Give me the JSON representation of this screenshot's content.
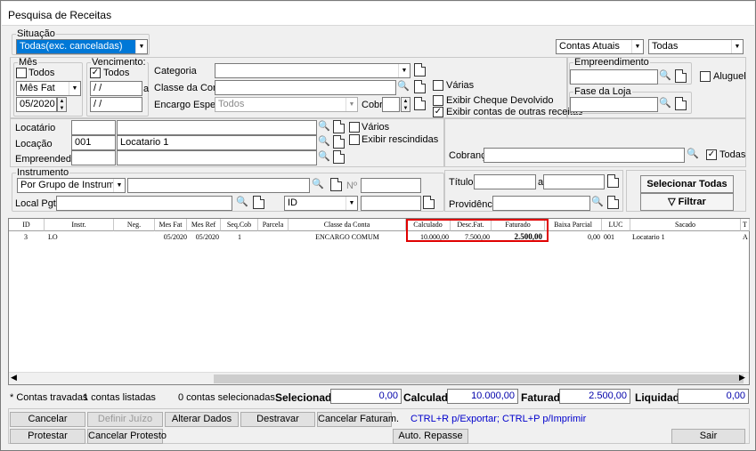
{
  "window": {
    "title": "Pesquisa de Receitas"
  },
  "situacao": {
    "legend": "Situação",
    "value": "Todas(exc. canceladas)"
  },
  "contas": {
    "value": "Contas Atuais",
    "todas": "Todas"
  },
  "mes": {
    "legend": "Mês",
    "todos_label": "Todos",
    "todos_checked": false,
    "tipo": "Mês Fat",
    "periodo": "05/2020"
  },
  "vencimento": {
    "legend": "Vencimento:",
    "todos_label": "Todos",
    "todos_checked": true,
    "de": "/ /",
    "a_label": "a",
    "ate": "/ /"
  },
  "categoria": {
    "label": "Categoria",
    "value": ""
  },
  "classe_conta": {
    "label": "Classe da Conta",
    "value": ""
  },
  "encargo": {
    "label": "Encargo Espec.",
    "value": "Todos"
  },
  "cobr": {
    "label": "Cobr",
    "value": ""
  },
  "varias": {
    "label": "Várias",
    "checked": false
  },
  "cheque": {
    "label": "Exibir Cheque Devolvido",
    "checked": false
  },
  "outras": {
    "label": "Exibir contas de outras receitas",
    "checked": true
  },
  "empreendimento": {
    "legend": "Empreendimento",
    "value": ""
  },
  "aluguel": {
    "label": "Aluguel",
    "checked": false
  },
  "fase": {
    "legend": "Fase da Loja",
    "value": ""
  },
  "locatario": {
    "label": "Locatário",
    "code": "",
    "name": ""
  },
  "locacao": {
    "label": "Locação",
    "code": "001",
    "name": "Locatario 1"
  },
  "empreendedor": {
    "label": "Empreendedor",
    "code": "",
    "name": ""
  },
  "varios": {
    "label": "Vários",
    "checked": false
  },
  "rescindidas": {
    "label": "Exibir rescindidas",
    "checked": false
  },
  "cobranca": {
    "label": "Cobrança",
    "value": "",
    "todas_label": "Todas",
    "todas_checked": true
  },
  "instrumento": {
    "legend": "Instrumento",
    "value": "Por Grupo de Instrumento",
    "no_label": "Nº",
    "no_value": ""
  },
  "local_pgto": {
    "label": "Local Pgto",
    "value": "",
    "id_value": "ID",
    "extra": ""
  },
  "titulo": {
    "label": "Título",
    "de": "",
    "a_label": "a",
    "ate": ""
  },
  "providencia": {
    "label": "Providência",
    "value": ""
  },
  "buttons": {
    "selecionar": "Selecionar Todas",
    "filtrar": "Filtrar"
  },
  "table": {
    "columns": [
      "ID",
      "Instr.",
      "Neg.",
      "Mes Fat",
      "Mes Ref",
      "Seq.Cob",
      "Parcela",
      "Classe da Conta",
      "Calculado",
      "Desc.Fat.",
      "Faturado",
      "Baixa Parcial",
      "LUC",
      "Sacado",
      "T"
    ],
    "rows": [
      [
        "3",
        "LO",
        "",
        "05/2020",
        "05/2020",
        "1",
        "",
        "ENCARGO COMUM",
        "10.000,00",
        "7.500,00",
        "2.500,00",
        "0,00",
        "001",
        "Locatario 1",
        "A"
      ]
    ]
  },
  "summary": {
    "travadas": "* Contas travadas",
    "listadas": "1 contas listadas",
    "selecionadas": "0 contas selecionadas",
    "selecionado_label": "Selecionado",
    "selecionado": "0,00",
    "calculado_label": "Calculado",
    "calculado": "10.000,00",
    "faturado_label": "Faturado",
    "faturado": "2.500,00",
    "liquidado_label": "Liquidado",
    "liquidado": "0,00"
  },
  "actions": {
    "cancelar": "Cancelar",
    "definir_juizo": "Definir Juízo",
    "alterar": "Alterar Dados",
    "destravar": "Destravar",
    "cancelar_faturam": "Cancelar Faturam.",
    "hint": "CTRL+R p/Exportar; CTRL+P p/Imprimir",
    "protestar": "Protestar",
    "cancelar_protesto": "Cancelar Protesto",
    "repasse": "Auto. Repasse",
    "sair": "Sair"
  },
  "colors": {
    "highlight": "#0078d7",
    "emphasis": "#e00000",
    "hint": "#0000cc"
  }
}
